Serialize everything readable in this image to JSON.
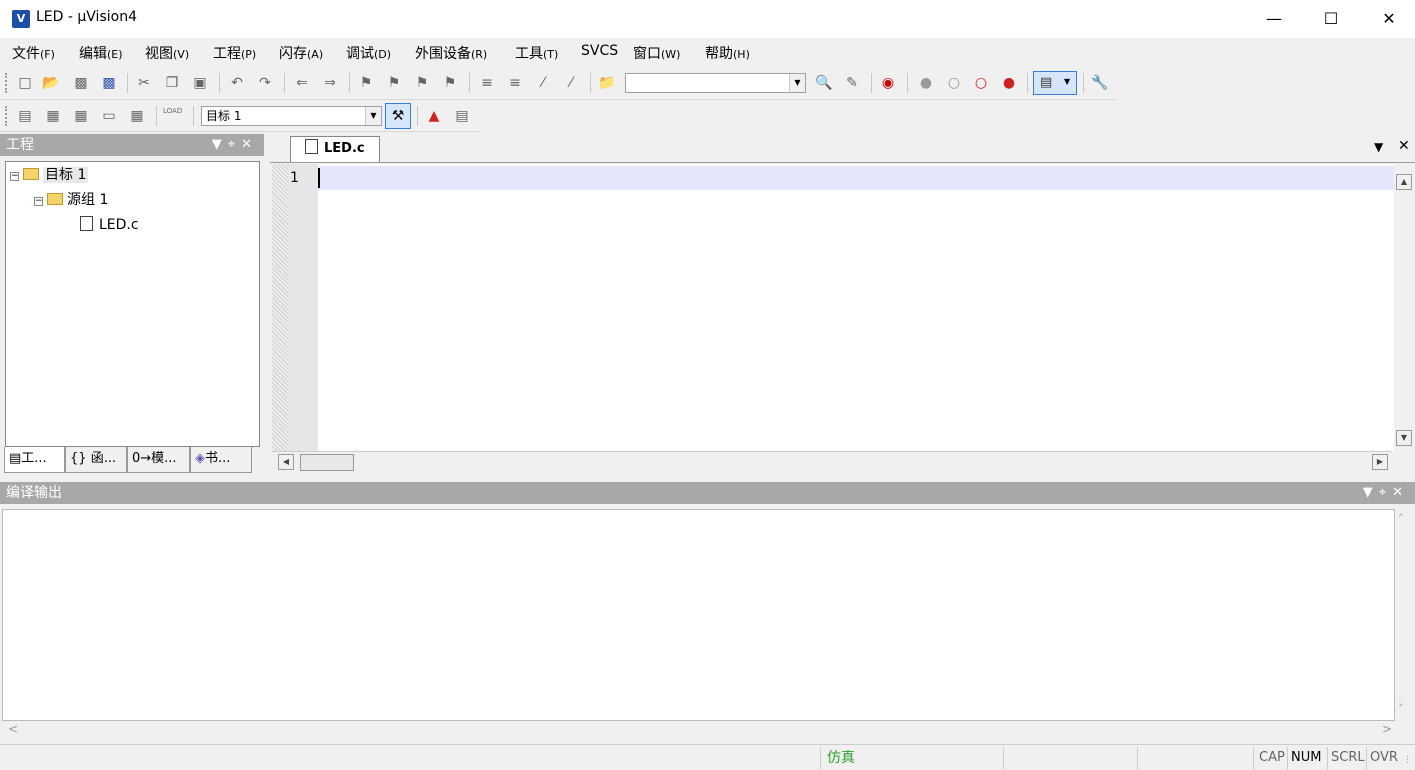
{
  "window": {
    "title": "LED  - µVision4",
    "min_icon": "minimize-icon",
    "max_icon": "maximize-icon",
    "close_icon": "close-icon"
  },
  "menubar": [
    {
      "label": "文件",
      "accel": "(F)"
    },
    {
      "label": "编辑",
      "accel": "(E)"
    },
    {
      "label": "视图",
      "accel": "(V)"
    },
    {
      "label": "工程",
      "accel": "(P)"
    },
    {
      "label": "闪存",
      "accel": "(A)"
    },
    {
      "label": "调试",
      "accel": "(D)"
    },
    {
      "label": "外围设备",
      "accel": "(R)"
    },
    {
      "label": "工具",
      "accel": "(T)"
    },
    {
      "label": "SVCS",
      "accel": ""
    },
    {
      "label": "窗口",
      "accel": "(W)"
    },
    {
      "label": "帮助",
      "accel": "(H)"
    }
  ],
  "toolbar2": {
    "target_combo": "目标 1",
    "load_label": "LOAD"
  },
  "project_panel": {
    "title": "工程",
    "tree": [
      {
        "label": "目标 1",
        "level": 0
      },
      {
        "label": "源组 1",
        "level": 1
      },
      {
        "label": "LED.c",
        "level": 2
      }
    ],
    "tabs": [
      "工...",
      "函...",
      "模...",
      "书..."
    ]
  },
  "editor": {
    "tab_label": "LED.c",
    "line_number": "1"
  },
  "build_output": {
    "title": "编译输出"
  },
  "statusbar": {
    "mode": "仿真",
    "cap": "CAP",
    "num": "NUM",
    "scrl": "SCRL",
    "ovr": "OVR"
  },
  "colors": {
    "accent_mode": "#2ea02e",
    "panel_header": "#a8a8a8",
    "current_line": "#e6e6fa"
  }
}
